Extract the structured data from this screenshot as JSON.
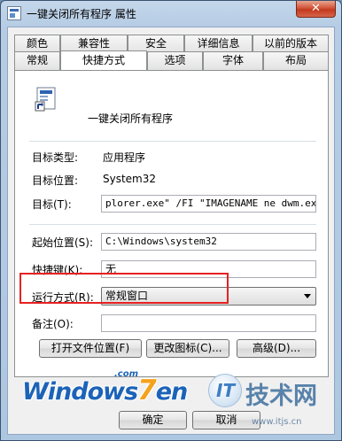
{
  "window": {
    "title": "一键关闭所有程序 属性",
    "close_glyph": "✕"
  },
  "tabs_row1": [
    "颜色",
    "兼容性",
    "安全",
    "详细信息",
    "以前的版本"
  ],
  "tabs_row2": [
    "常规",
    "快捷方式",
    "选项",
    "字体",
    "布局"
  ],
  "active_tab": "快捷方式",
  "shortcut": {
    "name": "一键关闭所有程序",
    "target_type_label": "目标类型:",
    "target_type_value": "应用程序",
    "target_location_label": "目标位置:",
    "target_location_value": "System32",
    "target_label": "目标(T):",
    "target_value": "plorer.exe\" /FI \"IMAGENAME ne dwm.exe\"a",
    "start_in_label": "起始位置(S):",
    "start_in_value": "C:\\Windows\\system32",
    "hotkey_label": "快捷键(K):",
    "hotkey_value": "无",
    "run_label": "运行方式(R):",
    "run_value": "常规窗口",
    "comment_label": "备注(O):",
    "comment_value": ""
  },
  "buttons": {
    "open_location": "打开文件位置(F)",
    "change_icon": "更改图标(C)...",
    "advanced": "高级(D)...",
    "ok": "确定",
    "cancel": "取消"
  },
  "watermark": {
    "logo_prefix": "Windows",
    "logo_seven": "7",
    "logo_suffix": "en",
    "logo_com": ".com",
    "right_badge": "IT",
    "right_text": "技术网",
    "right_url": "www.itjs.cn"
  },
  "colors": {
    "highlight": "#e62121",
    "close_button": "#c3391d",
    "window_frame": "#b5cce4"
  }
}
